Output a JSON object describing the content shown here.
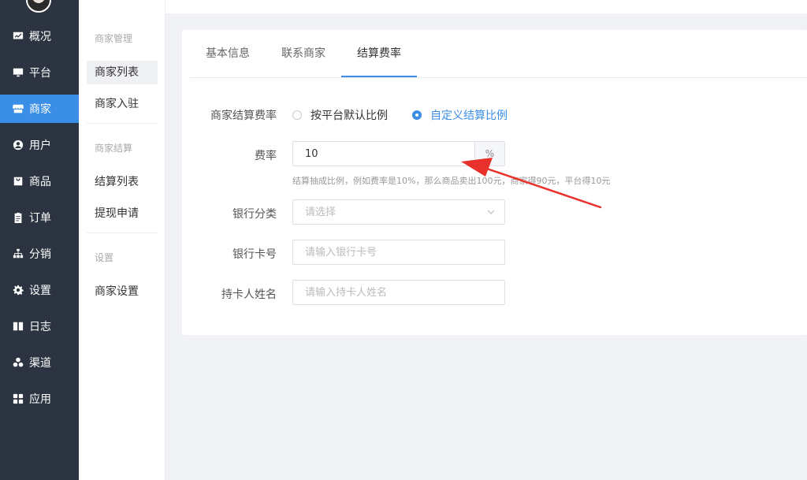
{
  "nav": {
    "items": [
      {
        "label": "概况",
        "icon": "chart-icon"
      },
      {
        "label": "平台",
        "icon": "monitor-icon"
      },
      {
        "label": "商家",
        "icon": "store-icon"
      },
      {
        "label": "用户",
        "icon": "user-icon"
      },
      {
        "label": "商品",
        "icon": "bag-icon"
      },
      {
        "label": "订单",
        "icon": "clipboard-icon"
      },
      {
        "label": "分销",
        "icon": "sitemap-icon"
      },
      {
        "label": "设置",
        "icon": "gear-icon"
      },
      {
        "label": "日志",
        "icon": "book-icon"
      },
      {
        "label": "渠道",
        "icon": "cubes-icon"
      },
      {
        "label": "应用",
        "icon": "grid-icon"
      }
    ],
    "active": "商家"
  },
  "submenu": {
    "group1": "商家管理",
    "item_list": "商家列表",
    "item_join": "商家入驻",
    "group2": "商家结算",
    "item_settle_list": "结算列表",
    "item_withdraw": "提现申请",
    "group3": "设置",
    "item_settings": "商家设置"
  },
  "tabs": {
    "basic": "基本信息",
    "contact": "联系商家",
    "settlement": "结算费率"
  },
  "form": {
    "rate_mode_label": "商家结算费率",
    "radio_default": "按平台默认比例",
    "radio_custom": "自定义结算比例",
    "rate_label": "费率",
    "rate_value": "10",
    "rate_unit": "%",
    "rate_hint": "结算抽成比例，例如费率是10%，那么商品卖出100元，商家得90元，平台得10元",
    "bank_category_label": "银行分类",
    "bank_category_placeholder": "请选择",
    "bank_card_label": "银行卡号",
    "bank_card_placeholder": "请输入银行卡号",
    "holder_label": "持卡人姓名",
    "holder_placeholder": "请输入持卡人姓名"
  },
  "colors": {
    "sidebar": "#2b3440",
    "accent": "#3a8ee6",
    "annotation_arrow": "#e8312a"
  }
}
